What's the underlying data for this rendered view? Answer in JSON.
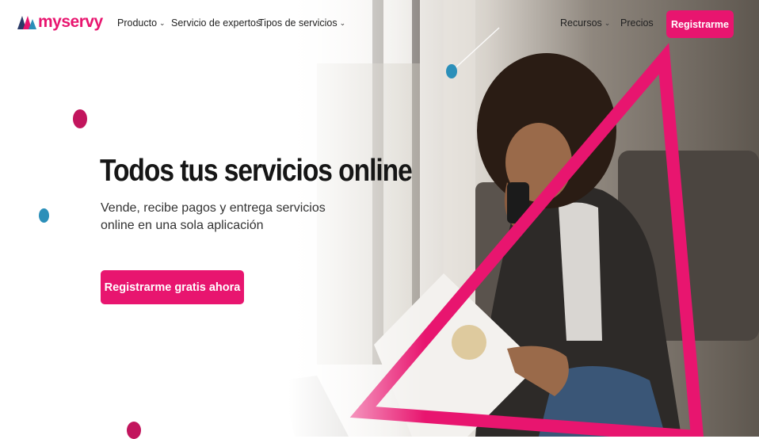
{
  "brand": {
    "logo_text": "myservy",
    "accent": "#e8156f",
    "secondary": "#2b8fb9"
  },
  "nav": {
    "items": [
      {
        "label": "Producto",
        "has_dropdown": true
      },
      {
        "label": "Servicio de expertos",
        "has_dropdown": false
      },
      {
        "label": "Tipos de servicios",
        "has_dropdown": true
      },
      {
        "label": "Recursos",
        "has_dropdown": true
      },
      {
        "label": "Precios",
        "has_dropdown": false
      }
    ],
    "cta_label": "Registrarme"
  },
  "hero": {
    "title": "Todos tus servicios online",
    "subtitle": "Vende, recibe pagos y entrega servicios online en una sola aplicación",
    "cta_label": "Registrarme gratis ahora"
  },
  "icons": {
    "dropdown": "chevron-down-icon",
    "logo": "myservy-logo-icon"
  }
}
